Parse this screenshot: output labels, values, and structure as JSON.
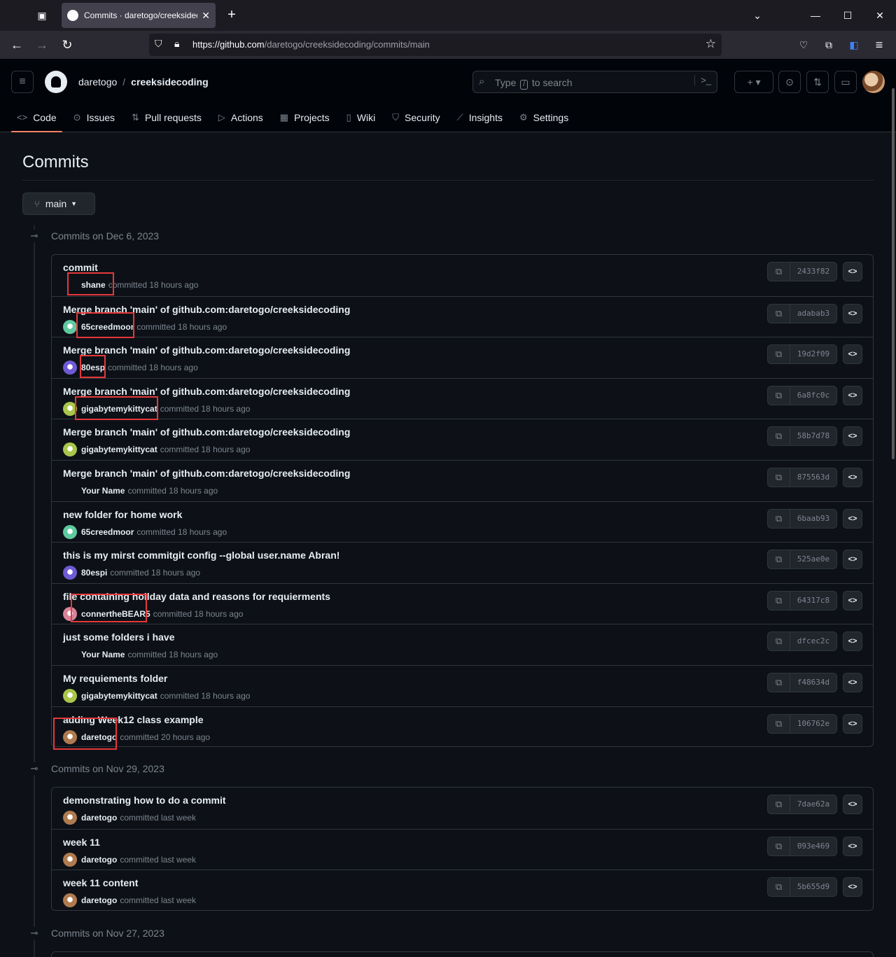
{
  "browser": {
    "tab_title": "Commits · daretogo/creeksidecoding",
    "url_host": "https://github.com",
    "url_path": "/daretogo/creeksidecoding/commits/main"
  },
  "header": {
    "owner": "daretogo",
    "separator": "/",
    "repo": "creeksidecoding",
    "search_prefix": "Type",
    "search_key": "/",
    "search_suffix": "to search"
  },
  "repo_nav": [
    {
      "label": "Code",
      "icon": "code-icon",
      "glyph": "<>"
    },
    {
      "label": "Issues",
      "icon": "issue-icon",
      "glyph": "⊙"
    },
    {
      "label": "Pull requests",
      "icon": "pull-request-icon",
      "glyph": "⇅"
    },
    {
      "label": "Actions",
      "icon": "play-icon",
      "glyph": "▷"
    },
    {
      "label": "Projects",
      "icon": "table-icon",
      "glyph": "▦"
    },
    {
      "label": "Wiki",
      "icon": "book-icon",
      "glyph": "▯"
    },
    {
      "label": "Security",
      "icon": "shield-icon",
      "glyph": "⛉"
    },
    {
      "label": "Insights",
      "icon": "graph-icon",
      "glyph": "⟋"
    },
    {
      "label": "Settings",
      "icon": "gear-icon",
      "glyph": "⚙"
    }
  ],
  "page": {
    "title": "Commits",
    "branch": "main"
  },
  "groups": [
    {
      "label": "Commits on Dec 6, 2023",
      "commits": [
        {
          "message": "commit",
          "author": "shane",
          "time": "committed 18 hours ago",
          "sha": "2433f82",
          "avatar": "none"
        },
        {
          "message": "Merge branch 'main' of github.com:daretogo/creeksidecoding",
          "author": "65creedmoor",
          "time": "committed 18 hours ago",
          "sha": "adabab3",
          "avatar": "#5fc9a0"
        },
        {
          "message": "Merge branch 'main' of github.com:daretogo/creeksidecoding",
          "author": "80esp",
          "time": "committed 18 hours ago",
          "sha": "19d2f09",
          "avatar": "#6f5ad6"
        },
        {
          "message": "Merge branch 'main' of github.com:daretogo/creeksidecoding",
          "author": "gigabytemykittycat",
          "time": "committed 18 hours ago",
          "sha": "6a8fc0c",
          "avatar": "#a8c64a"
        },
        {
          "message": "Merge branch 'main' of github.com:daretogo/creeksidecoding",
          "author": "gigabytemykittycat",
          "time": "committed 18 hours ago",
          "sha": "58b7d78",
          "avatar": "#a8c64a"
        },
        {
          "message": "Merge branch 'main' of github.com:daretogo/creeksidecoding",
          "author": "Your Name",
          "time": "committed 18 hours ago",
          "sha": "875563d",
          "avatar": "none"
        },
        {
          "message": "new folder for home work",
          "author": "65creedmoor",
          "time": "committed 18 hours ago",
          "sha": "6baab93",
          "avatar": "#5fc9a0"
        },
        {
          "message": "this is my mirst commitgit config --global user.name Abran!",
          "author": "80espi",
          "time": "committed 18 hours ago",
          "sha": "525ae0e",
          "avatar": "#6f5ad6"
        },
        {
          "message": "file containing hoilday data and reasons for requierments",
          "author": "connertheBEAR5",
          "time": "committed 18 hours ago",
          "sha": "64317c8",
          "avatar": "#d9849a"
        },
        {
          "message": "just some folders i have",
          "author": "Your Name",
          "time": "committed 18 hours ago",
          "sha": "dfcec2c",
          "avatar": "none"
        },
        {
          "message": "My requiements folder",
          "author": "gigabytemykittycat",
          "time": "committed 18 hours ago",
          "sha": "f48634d",
          "avatar": "#a8c64a"
        },
        {
          "message": "adding Week12 class example",
          "author": "daretogo",
          "time": "committed 20 hours ago",
          "sha": "106762e",
          "avatar": "#b07a50"
        }
      ]
    },
    {
      "label": "Commits on Nov 29, 2023",
      "commits": [
        {
          "message": "demonstrating how to do a commit",
          "author": "daretogo",
          "time": "committed last week",
          "sha": "7dae62a",
          "avatar": "#b07a50"
        },
        {
          "message": "week 11",
          "author": "daretogo",
          "time": "committed last week",
          "sha": "093e469",
          "avatar": "#b07a50"
        },
        {
          "message": "week 11 content",
          "author": "daretogo",
          "time": "committed last week",
          "sha": "5b655d9",
          "avatar": "#b07a50"
        }
      ]
    },
    {
      "label": "Commits on Nov 27, 2023",
      "commits": []
    }
  ]
}
